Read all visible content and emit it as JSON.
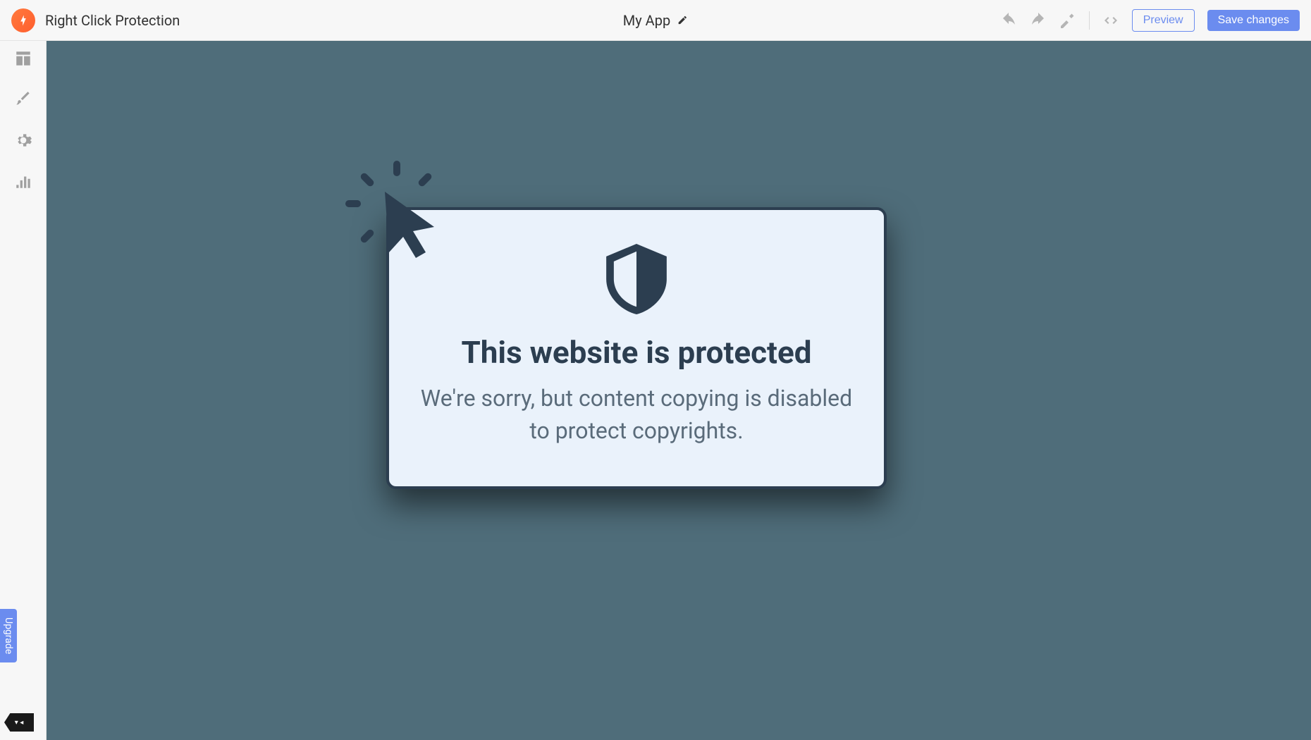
{
  "header": {
    "plugin_title": "Right Click Protection",
    "app_name": "My App"
  },
  "buttons": {
    "preview": "Preview",
    "save": "Save changes"
  },
  "sidebar": {
    "upgrade": "Upgrade"
  },
  "card": {
    "title": "This website is protected",
    "body": "We're sorry, but content copying is disabled to protect copyrights."
  }
}
